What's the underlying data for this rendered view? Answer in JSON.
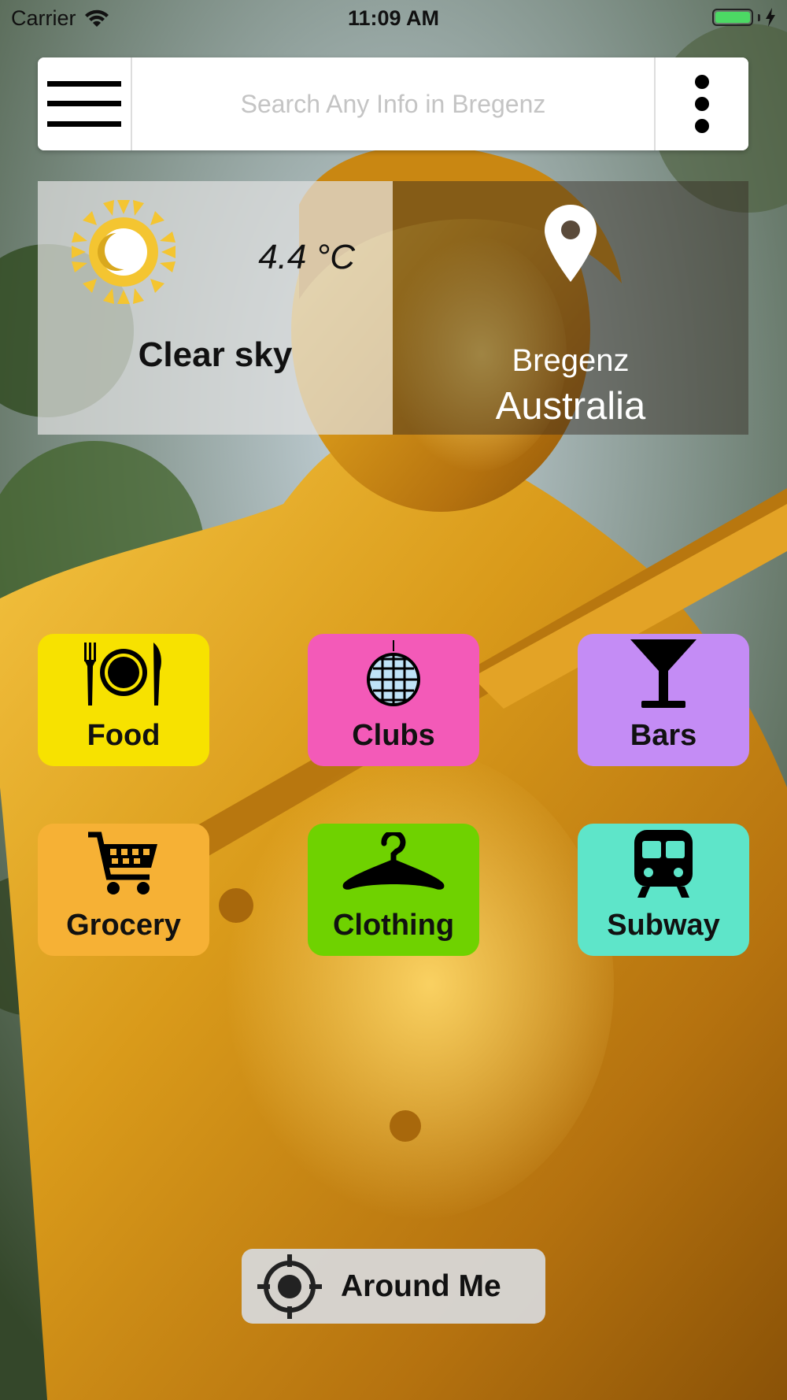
{
  "status_bar": {
    "carrier": "Carrier",
    "time": "11:09 AM",
    "battery_color": "#4cd964"
  },
  "search": {
    "placeholder": "Search Any Info in Bregenz",
    "value": "",
    "menu_icon": "hamburger-icon",
    "more_icon": "more-vertical-icon"
  },
  "weather": {
    "icon": "clear-night-sun-icon",
    "temperature": "4.4 °C",
    "condition": "Clear sky"
  },
  "location": {
    "icon": "map-pin-icon",
    "city": "Bregenz",
    "country": "Australia"
  },
  "categories": [
    {
      "label": "Food",
      "icon": "food-icon",
      "color": "#f7e200"
    },
    {
      "label": "Clubs",
      "icon": "disco-ball-icon",
      "color": "#f35ab8"
    },
    {
      "label": "Bars",
      "icon": "cocktail-icon",
      "color": "#c48cf5"
    },
    {
      "label": "Grocery",
      "icon": "shopping-cart-icon",
      "color": "#f6b135"
    },
    {
      "label": "Clothing",
      "icon": "hanger-icon",
      "color": "#6fd200"
    },
    {
      "label": "Subway",
      "icon": "train-icon",
      "color": "#5ee5c9"
    }
  ],
  "around_me": {
    "label": "Around Me",
    "icon": "crosshair-icon"
  }
}
